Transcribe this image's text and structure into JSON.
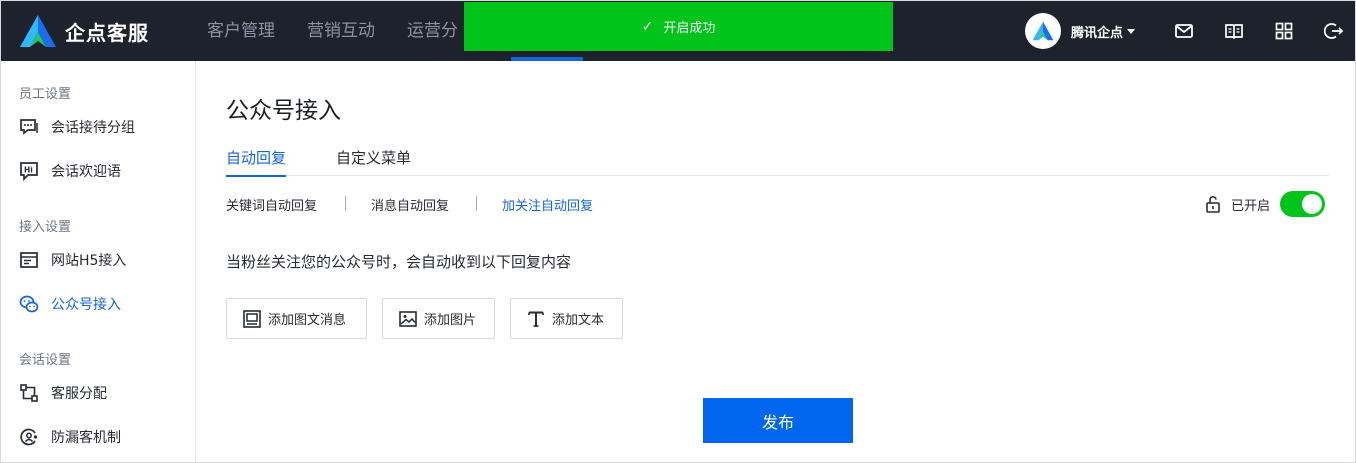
{
  "app": {
    "name": "企点客服"
  },
  "nav": {
    "items": [
      "客户管理",
      "营销互动",
      "运营分"
    ]
  },
  "toast": {
    "message": "开启成功"
  },
  "user": {
    "name": "腾讯企点"
  },
  "topbar_icons": [
    "mail-icon",
    "book-icon",
    "apps-grid-icon",
    "logout-icon"
  ],
  "sidebar": {
    "group_staff": "员工设置",
    "item_reception_group": "会话接待分组",
    "item_welcome": "会话欢迎语",
    "group_access": "接入设置",
    "item_h5": "网站H5接入",
    "item_official": "公众号接入",
    "group_session": "会话设置",
    "item_assign": "客服分配",
    "item_antileak": "防漏客机制"
  },
  "page": {
    "title": "公众号接入",
    "tab_auto_reply": "自动回复",
    "tab_custom_menu": "自定义菜单",
    "subtab_keyword": "关键词自动回复",
    "subtab_message": "消息自动回复",
    "subtab_follow": "加关注自动回复",
    "status_label": "已开启",
    "toggle_on": true,
    "description": "当粉丝关注您的公众号时，会自动收到以下回复内容",
    "btn_add_article": "添加图文消息",
    "btn_add_image": "添加图片",
    "btn_add_text": "添加文本",
    "publish": "发布"
  },
  "colors": {
    "topbar": "#1d222c",
    "accent": "#1565d8",
    "success": "#00c41a",
    "primary_button": "#0066ee"
  }
}
